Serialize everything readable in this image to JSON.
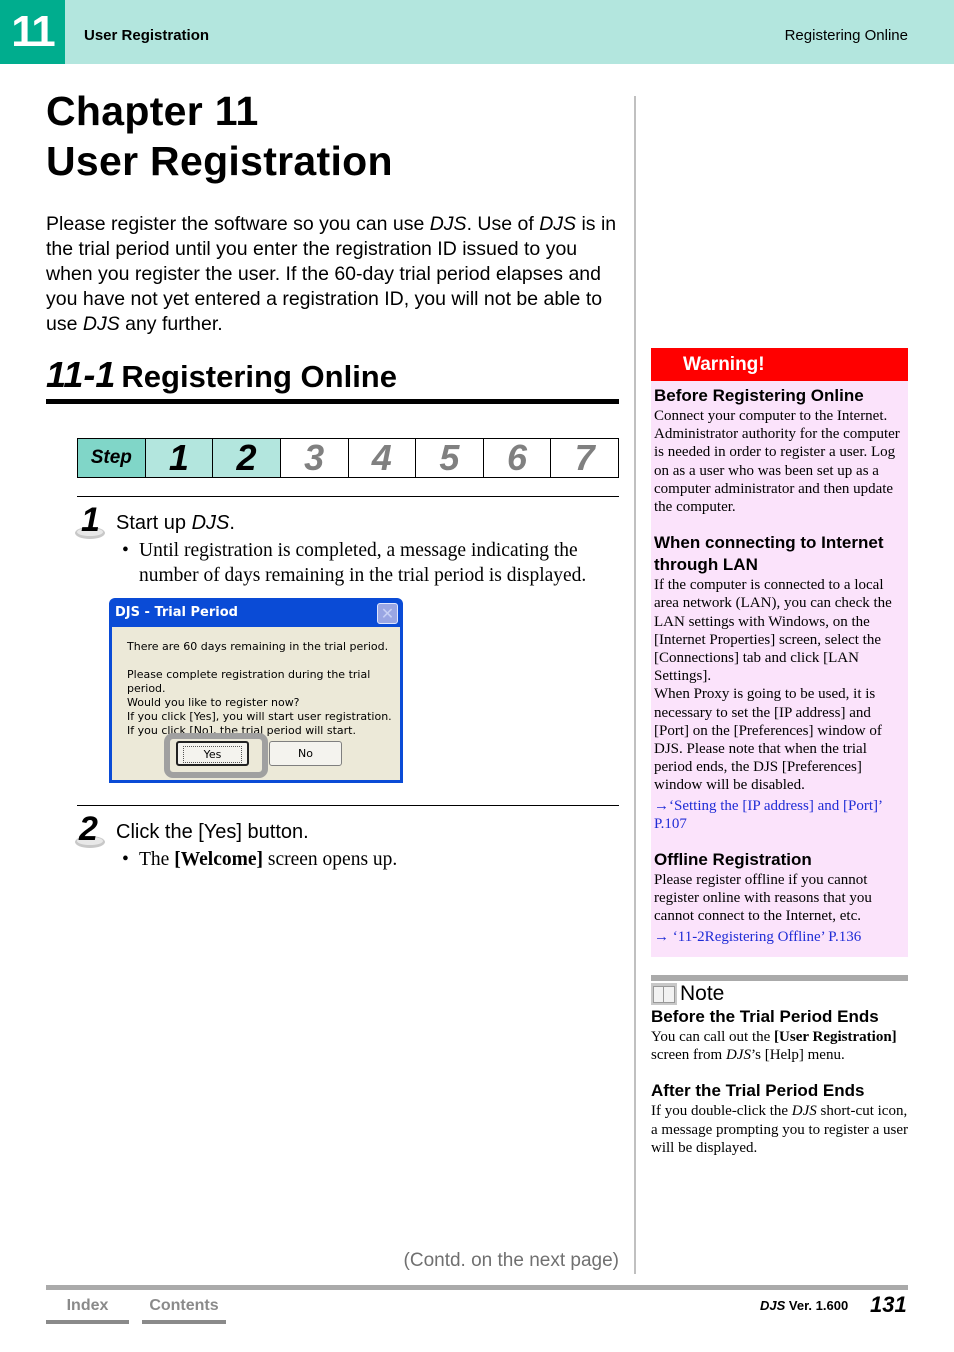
{
  "header": {
    "chapter_number": "11",
    "title": "User Registration",
    "section": "Registering Online"
  },
  "chapter": {
    "line1": "Chapter 11",
    "line2": "User Registration",
    "intro": [
      {
        "t": "Please register the software so you can use ",
        "i": false
      },
      {
        "t": "DJS",
        "i": true
      },
      {
        "t": ". Use of ",
        "i": false
      },
      {
        "t": "DJS",
        "i": true
      },
      {
        "t": " is in the trial period until you enter the registration ID issued to you when you register the user. If the 60-day trial period elapses and you have not yet entered a registration ID, you will not be able to use ",
        "i": false
      },
      {
        "t": "DJS",
        "i": true
      },
      {
        "t": " any further.",
        "i": false
      }
    ]
  },
  "section": {
    "number": "11-1",
    "title": "Registering Online"
  },
  "step_indicator": {
    "label": "Step",
    "steps": [
      "1",
      "2",
      "3",
      "4",
      "5",
      "6",
      "7"
    ],
    "completed_through": 2
  },
  "steps": [
    {
      "number": "1",
      "heading_plain": "Start up ",
      "heading_italic": "DJS",
      "heading_end": ".",
      "bullet": "Until registration is completed, a message indicating the number of days remaining in the trial period is displayed."
    },
    {
      "number": "2",
      "heading_plain": "Click the [Yes] button.",
      "bullet_pre": "The ",
      "bullet_bold": "[Welcome]",
      "bullet_post": " screen opens up."
    }
  ],
  "dialog": {
    "title": "DJS - Trial Period",
    "close": "✕",
    "line1": "There are 60 days remaining in the trial period.",
    "line2": "Please complete registration during the trial period.",
    "line3": "Would you like to register now?",
    "line4": "If you click [Yes], you will start user registration.",
    "line5": "If you click [No], the trial period will start.",
    "yes": "Yes",
    "no": "No"
  },
  "warning": {
    "label": "Warning!",
    "sections": [
      {
        "heading": "Before Registering Online",
        "text": "Connect your computer to the Internet. Administrator authority for the computer is needed in order to register a user. Log on as a user who was been set up as a computer administrator and then update the computer."
      },
      {
        "heading": "When connecting to Internet through LAN",
        "text": "If the computer is connected to a local area network (LAN), you can check the LAN settings with Windows, on the [Internet Properties] screen, select the [Connections] tab and click [LAN Settings].",
        "text2": "When Proxy is going to be used, it is necessary to set the [IP address] and [Port] on the [Preferences] window of DJS. Please note that when the trial period ends, the DJS [Preferences] window will be disabled.",
        "link": "→‘Setting the [IP address] and [Port]’ P.107"
      },
      {
        "heading": "Offline Registration",
        "text": "Please register offline if you cannot register online with reasons that you cannot connect to the Internet, etc.",
        "link": "→ ‘11-2Registering Offline’ P.136"
      }
    ]
  },
  "note": {
    "label": "Note",
    "sections": [
      {
        "heading": "Before the Trial Period Ends",
        "pre": "You can call out the ",
        "bold": "[User Registration]",
        "mid": " screen from ",
        "italic": "DJS",
        "post": "’s [Help] menu."
      },
      {
        "heading": "After the Trial Period Ends",
        "pre": "If you double-click the ",
        "italic": "DJS",
        "post": " short-cut icon, a message prompting you to register a user will be displayed."
      }
    ]
  },
  "footer": {
    "contd": "(Contd. on the next page)",
    "index": "Index",
    "contents": "Contents",
    "product": "DJS",
    "version": " Ver. 1.600",
    "page": "131"
  },
  "colors": {
    "header_bg": "#b3e6de",
    "chapter_tab": "#00ad8e",
    "warning_red": "#ff0000",
    "warning_bg": "#fbe3fb",
    "link_blue": "#1f2cd6"
  }
}
